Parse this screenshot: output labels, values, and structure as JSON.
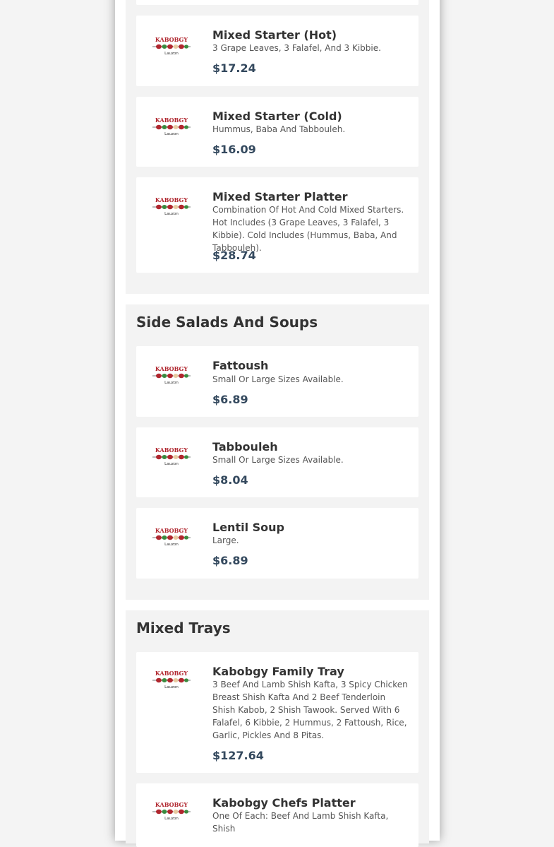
{
  "brand": {
    "logo_text": "KABOBGY",
    "logo_subtext": "Lauzon"
  },
  "sections": [
    {
      "title": "",
      "items": [
        {
          "name": "Mixed Starter (Hot)",
          "description": "3 Grape Leaves, 3 Falafel, And 3 Kibbie.",
          "price": "$17.24"
        },
        {
          "name": "Mixed Starter (Cold)",
          "description": "Hummus, Baba And Tabbouleh.",
          "price": "$16.09"
        },
        {
          "name": "Mixed Starter Platter",
          "description": "Combination Of Hot And Cold Mixed Starters. Hot Includes (3 Grape Leaves, 3 Falafel, 3 Kibbie). Cold Includes (Hummus, Baba, And Tabbouleh).",
          "price": "$28.74"
        }
      ]
    },
    {
      "title": "Side Salads And Soups",
      "items": [
        {
          "name": "Fattoush",
          "description": "Small Or Large Sizes Available.",
          "price": "$6.89"
        },
        {
          "name": "Tabbouleh",
          "description": "Small Or Large Sizes Available.",
          "price": "$8.04"
        },
        {
          "name": "Lentil Soup",
          "description": "Large.",
          "price": "$6.89"
        }
      ]
    },
    {
      "title": "Mixed Trays",
      "items": [
        {
          "name": "Kabobgy Family Tray",
          "description": "3 Beef And Lamb Shish Kafta, 3 Spicy Chicken Breast Shish Kafta And 2 Beef Tenderloin Shish Kabob, 2 Shish Tawook. Served With 6 Falafel, 6 Kibbie, 2 Hummus, 2 Fattoush, Rice, Garlic, Pickles And 8 Pitas.",
          "price": "$127.64"
        },
        {
          "name": "Kabobgy Chefs Platter",
          "description": "One Of Each: Beef And Lamb Shish Kafta, Shish",
          "price": ""
        }
      ]
    }
  ],
  "colors": {
    "price": "#34495e",
    "logo_red": "#b0262e",
    "logo_green": "#3a8a3f",
    "section_bg": "#f3f3f3"
  }
}
